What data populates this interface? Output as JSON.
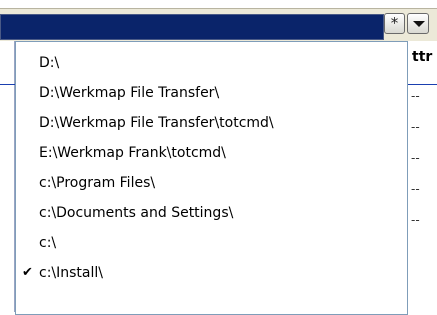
{
  "toolbar": {
    "star_label": "*",
    "dropdown_icon": "triangle-down-icon"
  },
  "header": {
    "attr_col": "ttr"
  },
  "attr_cells": [
    "--",
    "--",
    "--",
    "--",
    "--"
  ],
  "history": {
    "items": [
      {
        "label": "D:\\",
        "checked": false
      },
      {
        "label": "D:\\Werkmap File Transfer\\",
        "checked": false
      },
      {
        "label": "D:\\Werkmap File Transfer\\totcmd\\",
        "checked": false
      },
      {
        "label": "E:\\Werkmap Frank\\totcmd\\",
        "checked": false
      },
      {
        "label": "c:\\Program Files\\",
        "checked": false
      },
      {
        "label": "c:\\Documents and Settings\\",
        "checked": false
      },
      {
        "label": "c:\\",
        "checked": false
      },
      {
        "label": "c:\\Install\\",
        "checked": true
      }
    ],
    "check_mark": "✔"
  }
}
